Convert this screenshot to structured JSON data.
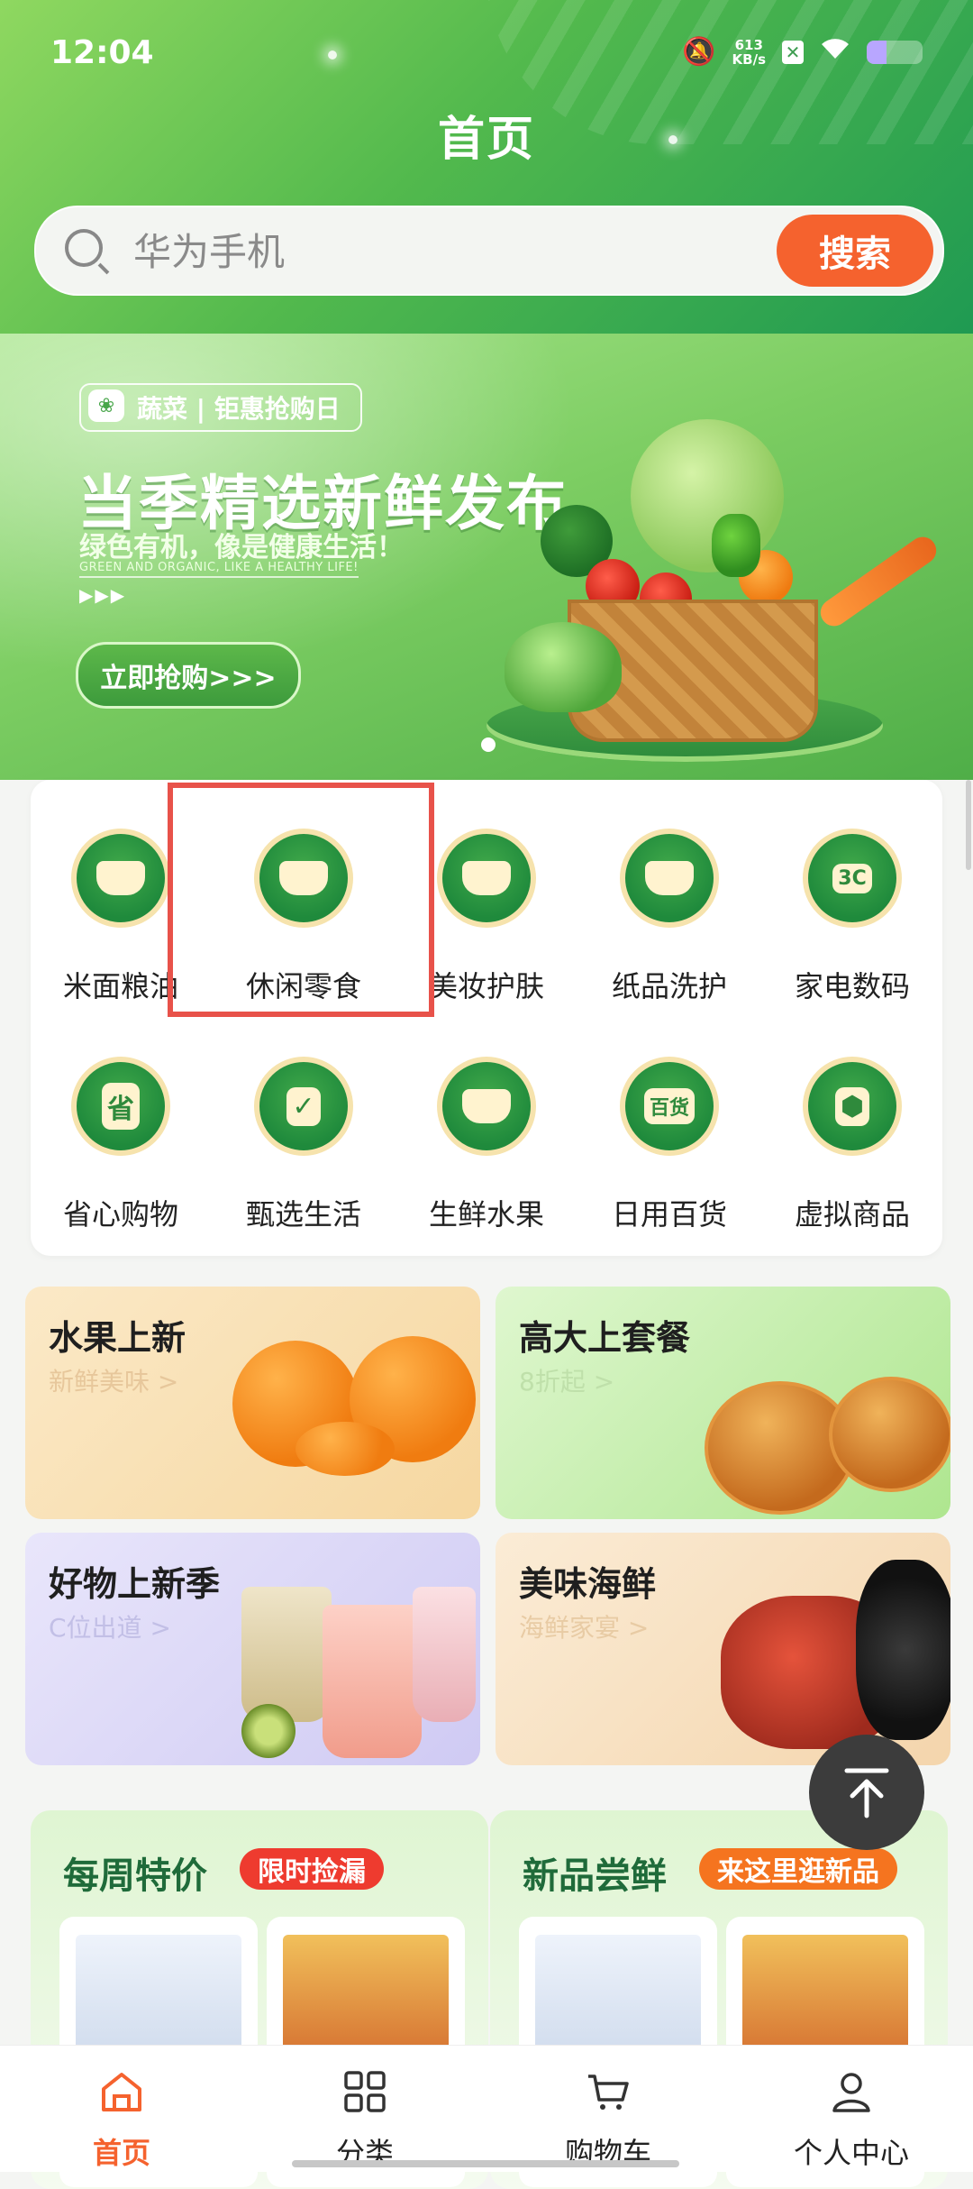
{
  "status_bar": {
    "time": "12:04",
    "net_speed_value": "613",
    "net_speed_unit": "KB/s",
    "battery_level": 0.35
  },
  "header": {
    "title": "首页"
  },
  "search": {
    "placeholder": "华为手机",
    "button_label": "搜索"
  },
  "banner": {
    "tag": "蔬菜 | 钜惠抢购日",
    "headline": "当季精选新鲜发布",
    "subtitle": "绿色有机，像是健康生活！",
    "subtitle_en": "GREEN AND ORGANIC, LIKE A HEALTHY LIFE!",
    "arrows": "▶▶▶",
    "button_label": "立即抢购>>>"
  },
  "categories": [
    {
      "label": "米面粮油",
      "icon": "rice-bowl-icon"
    },
    {
      "label": "休闲零食",
      "icon": "cake-icon"
    },
    {
      "label": "美妆护肤",
      "icon": "cosmetics-icon"
    },
    {
      "label": "纸品洗护",
      "icon": "tissue-icon"
    },
    {
      "label": "家电数码",
      "icon": "3c-icon",
      "glyph": "3C"
    },
    {
      "label": "省心购物",
      "icon": "save-icon",
      "glyph": "省"
    },
    {
      "label": "甄选生活",
      "icon": "check-basket-icon",
      "glyph": "✓"
    },
    {
      "label": "生鲜水果",
      "icon": "fresh-basket-icon"
    },
    {
      "label": "日用百货",
      "icon": "bag-icon",
      "glyph": "百货"
    },
    {
      "label": "虚拟商品",
      "icon": "box-icon",
      "glyph": "⬢"
    }
  ],
  "promos": [
    {
      "title": "水果上新",
      "sub": "新鲜美味 >"
    },
    {
      "title": "高大上套餐",
      "sub": "8折起 >"
    },
    {
      "title": "好物上新季",
      "sub": "C位出道 >"
    },
    {
      "title": "美味海鲜",
      "sub": "海鲜家宴 >"
    }
  ],
  "features": [
    {
      "title": "每周特价",
      "badge": "限时捡漏",
      "badge_color": "#ee3b2f"
    },
    {
      "title": "新品尝鲜",
      "badge": "来这里逛新品",
      "badge_color": "#f5741f"
    }
  ],
  "tabbar": [
    {
      "label": "首页",
      "icon": "home-icon",
      "active": true
    },
    {
      "label": "分类",
      "icon": "grid-icon"
    },
    {
      "label": "购物车",
      "icon": "cart-icon"
    },
    {
      "label": "个人中心",
      "icon": "user-icon"
    }
  ],
  "colors": {
    "accent": "#f5622e",
    "brand_green": "#1f8a3c",
    "highlight_box": "#e8524a"
  }
}
